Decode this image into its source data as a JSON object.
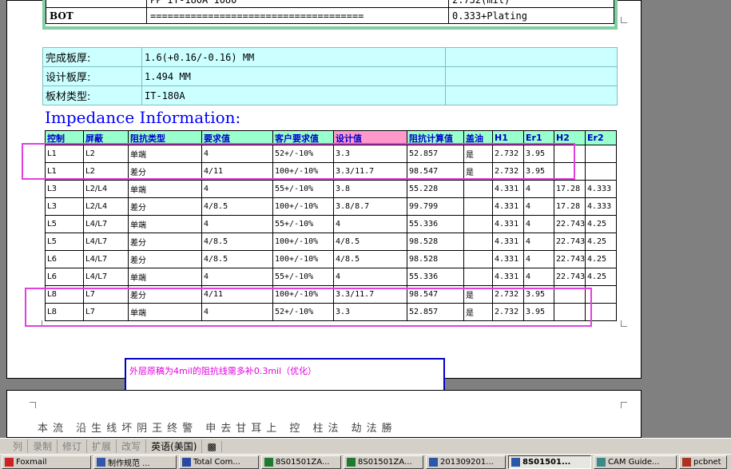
{
  "stackup": {
    "row1": {
      "c1": "",
      "c2": "PP     IT-180A    1080",
      "c3": "2.732(mil)"
    },
    "row2": {
      "c1": "BOT",
      "c2": "=====================================",
      "c3": "0.333+Plating"
    }
  },
  "info": [
    {
      "label": "完成板厚:",
      "value": "1.6(+0.16/-0.16) MM"
    },
    {
      "label": "设计板厚:",
      "value": "1.494 MM"
    },
    {
      "label": "板材类型:",
      "value": "IT-180A"
    }
  ],
  "title": "Impedance Information:",
  "headers": [
    "控制",
    "屏蔽",
    "阻抗类型",
    "要求值",
    "客户要求值",
    "设计值",
    "阻抗计算值",
    "盖油",
    "H1",
    "Er1",
    "H2",
    "Er2"
  ],
  "rows": [
    [
      "L1",
      "L2",
      "单端",
      "4",
      "52+/-10%",
      "3.3",
      "52.857",
      "是",
      "2.732",
      "3.95",
      "",
      ""
    ],
    [
      "L1",
      "L2",
      "差分",
      "4/11",
      "100+/-10%",
      "3.3/11.7",
      "98.547",
      "是",
      "2.732",
      "3.95",
      "",
      ""
    ],
    [
      "L3",
      "L2/L4",
      "单端",
      "4",
      "55+/-10%",
      "3.8",
      "55.228",
      "",
      "4.331",
      "4",
      "17.28",
      "4.333"
    ],
    [
      "L3",
      "L2/L4",
      "差分",
      "4/8.5",
      "100+/-10%",
      "3.8/8.7",
      "99.799",
      "",
      "4.331",
      "4",
      "17.28",
      "4.333"
    ],
    [
      "L5",
      "L4/L7",
      "单端",
      "4",
      "55+/-10%",
      "4",
      "55.336",
      "",
      "4.331",
      "4",
      "22.743",
      "4.25"
    ],
    [
      "L5",
      "L4/L7",
      "差分",
      "4/8.5",
      "100+/-10%",
      "4/8.5",
      "98.528",
      "",
      "4.331",
      "4",
      "22.743",
      "4.25"
    ],
    [
      "L6",
      "L4/L7",
      "差分",
      "4/8.5",
      "100+/-10%",
      "4/8.5",
      "98.528",
      "",
      "4.331",
      "4",
      "22.743",
      "4.25"
    ],
    [
      "L6",
      "L4/L7",
      "单端",
      "4",
      "55+/-10%",
      "4",
      "55.336",
      "",
      "4.331",
      "4",
      "22.743",
      "4.25"
    ],
    [
      "L8",
      "L7",
      "差分",
      "4/11",
      "100+/-10%",
      "3.3/11.7",
      "98.547",
      "是",
      "2.732",
      "3.95",
      "",
      ""
    ],
    [
      "L8",
      "L7",
      "单端",
      "4",
      "52+/-10%",
      "3.3",
      "52.857",
      "是",
      "2.732",
      "3.95",
      "",
      ""
    ]
  ],
  "note": "外层原稿为4mil的阻抗线需多补0.3mil（优化）",
  "page2_text": "本流 沿生线坏阴王终警 申去甘耳上 控 柱法 劫法勝",
  "status": [
    "列",
    "录制",
    "修订",
    "扩展",
    "改写",
    "英语(美国)"
  ],
  "taskbar": [
    {
      "label": "Foxmail",
      "icon": "foxmail-icon",
      "color": "#cc2222"
    },
    {
      "label": "制作规范 ...",
      "icon": "document-icon",
      "color": "#3355aa"
    },
    {
      "label": "Total Com...",
      "icon": "disk-icon",
      "color": "#2a4aa0"
    },
    {
      "label": "8S01501ZA...",
      "icon": "excel-icon",
      "color": "#1f7a2f"
    },
    {
      "label": "8S01501ZA...",
      "icon": "excel-icon",
      "color": "#1f7a2f"
    },
    {
      "label": "201309201...",
      "icon": "word-icon",
      "color": "#2b57a8"
    },
    {
      "label": "8S01501...",
      "icon": "word-icon",
      "color": "#2b57a8"
    },
    {
      "label": "CAM Guide...",
      "icon": "cam-icon",
      "color": "#3a8a8a"
    },
    {
      "label": "pcbnet",
      "icon": "pcbnet-icon",
      "color": "#aa3322"
    }
  ]
}
